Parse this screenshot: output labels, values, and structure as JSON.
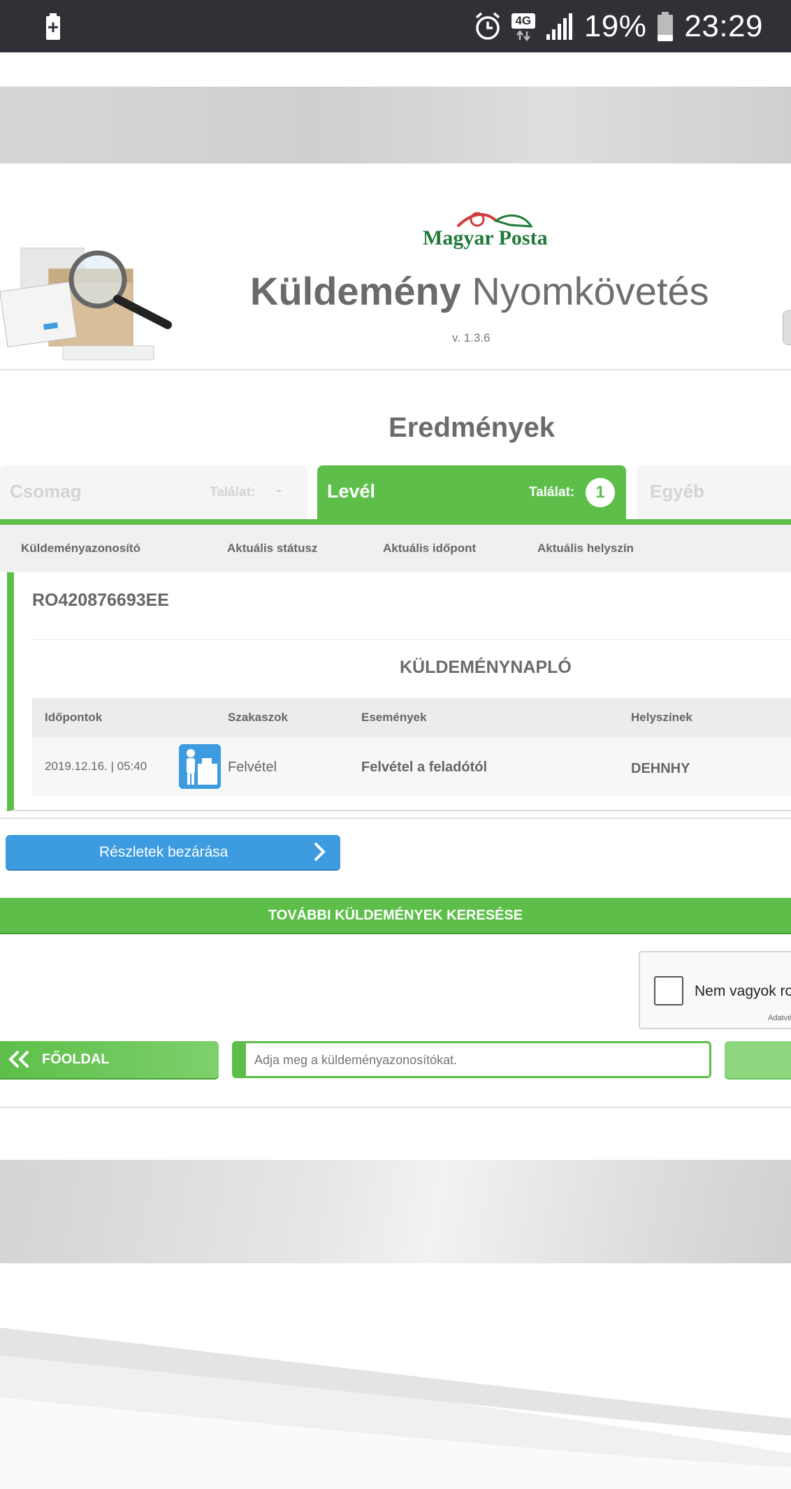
{
  "status_bar": {
    "network": "4G",
    "battery_percent": "19%",
    "time": "23:29"
  },
  "header": {
    "logo_text": "Magyar Posta",
    "title_bold": "Küldemény",
    "title_rest": "Nyomkövetés",
    "version": "v. 1.3.6"
  },
  "results": {
    "title": "Eredmények",
    "tabs": [
      {
        "label": "Csomag",
        "hits_label": "Találat:",
        "count": "-",
        "active": false
      },
      {
        "label": "Levél",
        "hits_label": "Találat:",
        "count": "1",
        "active": true
      },
      {
        "label": "Egyéb",
        "active": false
      }
    ],
    "columns": [
      "Küldeményazonosító",
      "Aktuális státusz",
      "Aktuális időpont",
      "Aktuális helyszín"
    ],
    "item": {
      "tracking_id": "RO420876693EE",
      "log_title": "KÜLDEMÉNYNAPLÓ",
      "log_columns": [
        "Időpontok",
        "Szakaszok",
        "Események",
        "Helyszínek"
      ],
      "log_rows": [
        {
          "time": "2019.12.16. | 05:40",
          "stage": "Felvétel",
          "event": "Felvétel a feladótól",
          "location": "DEHNHY"
        }
      ]
    }
  },
  "actions": {
    "close_details": "Részletek bezárása",
    "more_search": "TOVÁBBI KÜLDEMÉNYEK KERESÉSE",
    "home": "FŐOLDAL",
    "search_placeholder": "Adja meg a küldeményazonosítókat."
  },
  "captcha": {
    "label": "Nem vagyok rol",
    "small": "Adatvé"
  },
  "colors": {
    "green": "#5dbf4a",
    "blue": "#3d9be0",
    "status_bar": "#2f3136"
  }
}
